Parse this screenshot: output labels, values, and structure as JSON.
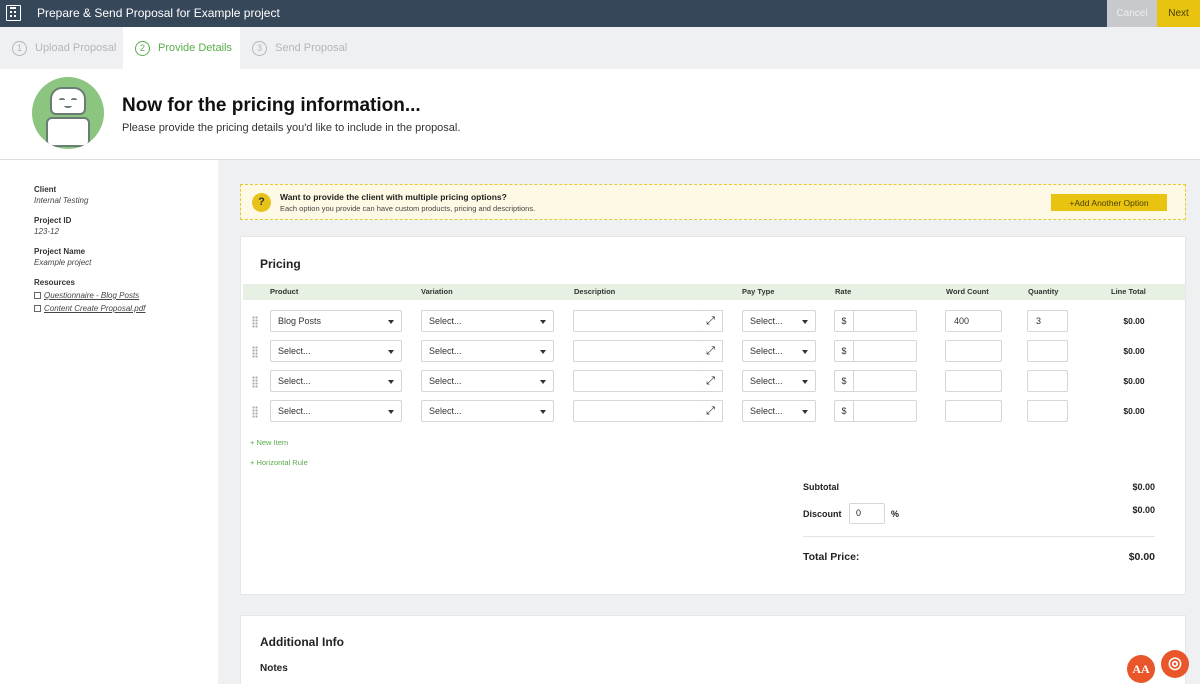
{
  "topbar": {
    "title": "Prepare & Send Proposal for Example project",
    "cancel_label": "Cancel",
    "next_label": "Next"
  },
  "steps": [
    {
      "num": "1",
      "label": "Upload Proposal",
      "state": "inactive"
    },
    {
      "num": "2",
      "label": "Provide Details",
      "state": "active"
    },
    {
      "num": "3",
      "label": "Send Proposal",
      "state": "inactive"
    }
  ],
  "header": {
    "title": "Now for the pricing information...",
    "subtitle": "Please provide the pricing details you'd like to include in the proposal."
  },
  "sidebar": {
    "client_label": "Client",
    "client_value": "Internal Testing",
    "project_id_label": "Project ID",
    "project_id_value": "123-12",
    "project_name_label": "Project Name",
    "project_name_value": "Example project",
    "resources_label": "Resources",
    "resources": [
      "Questionnaire - Blog Posts",
      "Content Create Proposal.pdf"
    ]
  },
  "callout": {
    "icon": "?",
    "title": "Want to provide the client with multiple pricing options?",
    "text": "Each option you provide can have custom products, pricing and descriptions.",
    "button_label": "+Add Another Option"
  },
  "pricing": {
    "title": "Pricing",
    "columns": {
      "product": "Product",
      "variation": "Variation",
      "description": "Description",
      "pay_type": "Pay Type",
      "rate": "Rate",
      "word_count": "Word Count",
      "quantity": "Quantity",
      "line_total": "Line Total"
    },
    "rows": [
      {
        "product": "Blog Posts",
        "variation": "Select...",
        "pay_type": "Select...",
        "currency": "$",
        "rate": "",
        "word_count": "400",
        "quantity": "3",
        "line_total": "$0.00"
      },
      {
        "product": "Select...",
        "variation": "Select...",
        "pay_type": "Select...",
        "currency": "$",
        "rate": "",
        "word_count": "",
        "quantity": "",
        "line_total": "$0.00"
      },
      {
        "product": "Select...",
        "variation": "Select...",
        "pay_type": "Select...",
        "currency": "$",
        "rate": "",
        "word_count": "",
        "quantity": "",
        "line_total": "$0.00"
      },
      {
        "product": "Select...",
        "variation": "Select...",
        "pay_type": "Select...",
        "currency": "$",
        "rate": "",
        "word_count": "",
        "quantity": "",
        "line_total": "$0.00"
      }
    ],
    "new_item_label": "+ New Item",
    "horizontal_rule_label": "+ Horizontal Rule",
    "subtotal_label": "Subtotal",
    "subtotal_value": "$0.00",
    "discount_label": "Discount",
    "discount_value": "0",
    "discount_unit": "%",
    "discount_amount": "$0.00",
    "total_label": "Total Price:",
    "total_value": "$0.00"
  },
  "additional": {
    "title": "Additional Info",
    "notes_label": "Notes"
  },
  "fabs": {
    "font_label": "AA",
    "help_label": "◎"
  },
  "colors": {
    "topbar": "#36475a",
    "accent_green": "#5bab4e",
    "accent_yellow": "#e8c410",
    "fab_orange": "#e8562a"
  }
}
